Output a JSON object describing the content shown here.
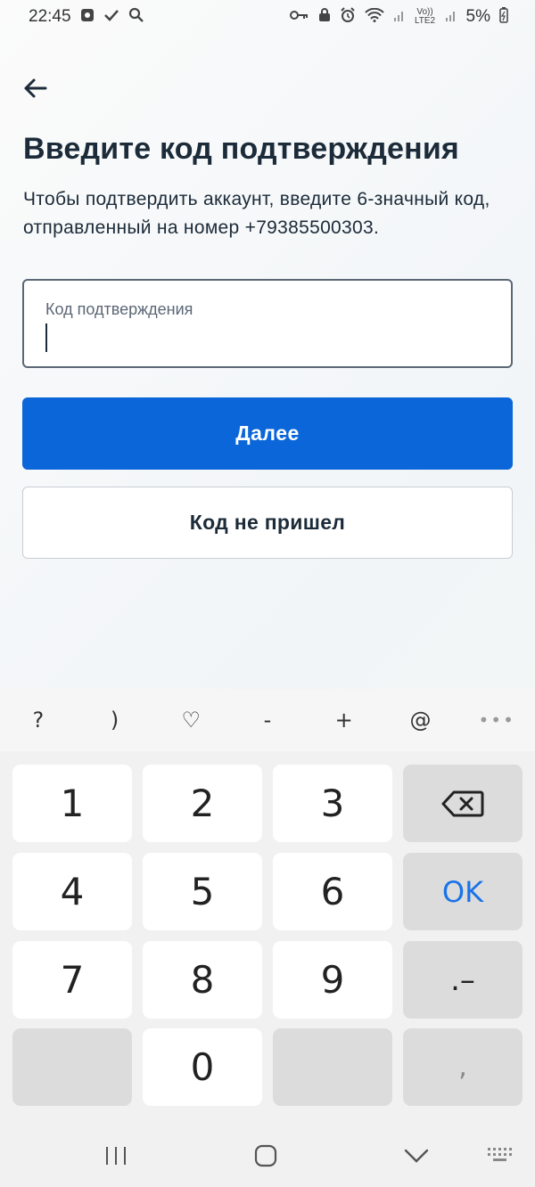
{
  "status_bar": {
    "time": "22:45",
    "battery": "5%",
    "network_label": "Vo)) LTE2",
    "icons": [
      "notification-app-icon",
      "check-icon",
      "search-icon",
      "key-icon",
      "lock-icon",
      "alarm-icon",
      "wifi-icon",
      "signal-icon",
      "signal-icon",
      "battery-icon"
    ]
  },
  "header": {
    "back_icon": "back-arrow-icon"
  },
  "main": {
    "title": "Введите код подтверждения",
    "subtitle": "Чтобы подтвердить аккаунт, введите 6-значный код, отправленный на номер +79385500303.",
    "code_field": {
      "label": "Код подтверждения",
      "value": ""
    },
    "next_button": "Далее",
    "no_code_button": "Код не пришел"
  },
  "keyboard": {
    "symbols": [
      "?",
      ")",
      "♡",
      "-",
      "+",
      "@",
      "•••"
    ],
    "rows": [
      [
        "1",
        "2",
        "3",
        "backspace"
      ],
      [
        "4",
        "5",
        "6",
        "OK"
      ],
      [
        "7",
        "8",
        "9",
        ".–"
      ],
      [
        "",
        "0",
        "",
        ","
      ]
    ],
    "colors": {
      "ok": "#1a73e8",
      "key_bg": "#ffffff",
      "dark_key_bg": "#dcdcdc"
    }
  },
  "colors": {
    "primary": "#0a66d9",
    "text": "#1c2b39"
  }
}
